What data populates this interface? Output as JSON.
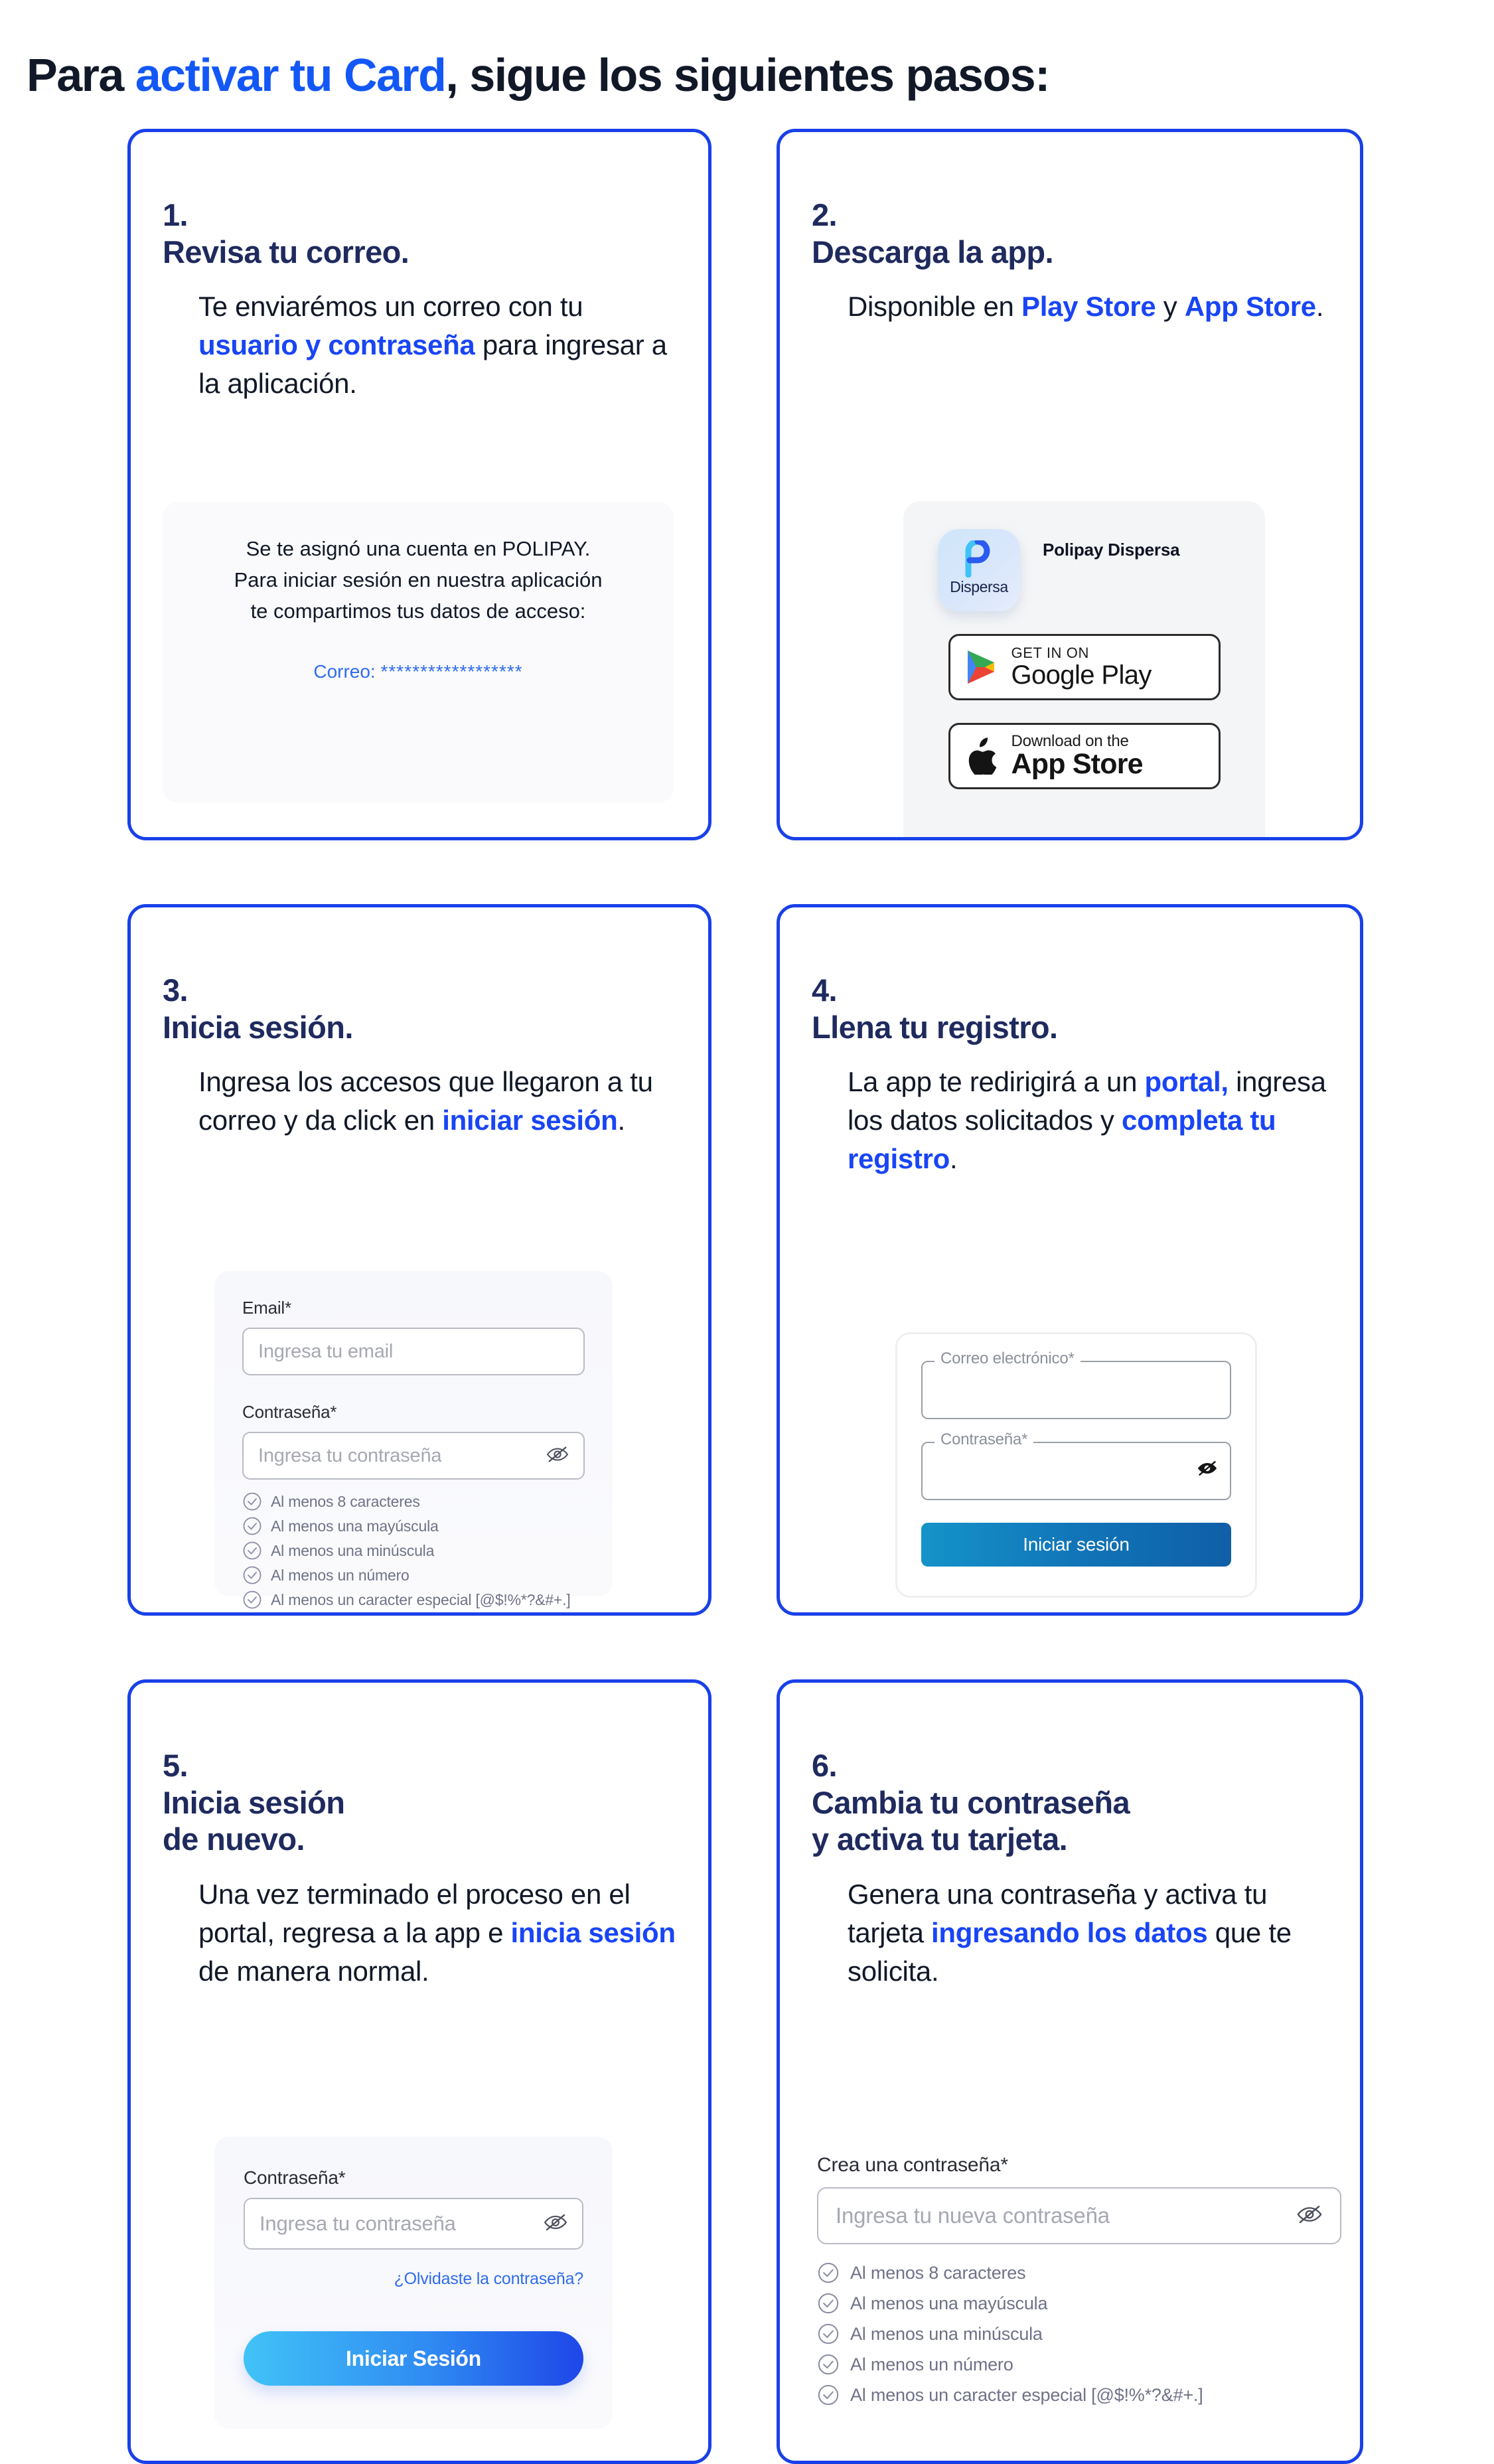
{
  "title": {
    "prefix": "Para ",
    "highlight": "activar tu Card",
    "suffix": ", sigue los siguientes pasos:"
  },
  "steps": [
    {
      "number": "1.",
      "heading": "Revisa tu correo.",
      "body_parts": [
        {
          "text": "Te enviarémos un correo con tu ",
          "style": "normal"
        },
        {
          "text": "usuario y contraseña",
          "style": "highlight"
        },
        {
          "text": " para ingresar a la aplicación.",
          "style": "normal"
        }
      ],
      "email_mock": {
        "body": "Se te asignó una cuenta en POLIPAY. Para iniciar sesión en nuestra aplicación te compartimos tus datos de acceso:",
        "field_label": "Correo:",
        "field_value": "******************"
      }
    },
    {
      "number": "2.",
      "heading": "Descarga la app.",
      "body_parts": [
        {
          "text": "Disponible en ",
          "style": "normal"
        },
        {
          "text": "Play Store",
          "style": "highlight"
        },
        {
          "text": " y ",
          "style": "normal"
        },
        {
          "text": "App Store",
          "style": "highlight"
        },
        {
          "text": ".",
          "style": "normal"
        }
      ],
      "store_mock": {
        "app_icon_name": "Dispersa",
        "app_title": "Polipay Dispersa",
        "google_badge": {
          "top": "GET IN ON",
          "main": "Google Play",
          "icon": "google-play-icon"
        },
        "apple_badge": {
          "top": "Download on the",
          "main": "App Store",
          "icon": "apple-icon"
        }
      }
    },
    {
      "number": "3.",
      "heading": "Inicia sesión.",
      "body_parts": [
        {
          "text": "Ingresa los accesos que llegaron a tu correo y da click en ",
          "style": "normal"
        },
        {
          "text": "iniciar sesión",
          "style": "highlight"
        },
        {
          "text": ".",
          "style": "normal"
        }
      ],
      "form_mock": {
        "email_label": "Email*",
        "email_placeholder": "Ingresa tu email",
        "password_label": "Contraseña*",
        "password_placeholder": "Ingresa tu contraseña",
        "eye_icon": "eye-off-icon",
        "rules": [
          "Al menos 8 caracteres",
          "Al menos una mayúscula",
          "Al menos una minúscula",
          "Al menos un número",
          "Al menos un caracter especial [@$!%*?&#+.]"
        ]
      }
    },
    {
      "number": "4.",
      "heading": "Llena tu registro.",
      "body_parts": [
        {
          "text": "La app te redirigirá a un ",
          "style": "normal"
        },
        {
          "text": "portal,",
          "style": "highlight"
        },
        {
          "text": " ingresa los datos solicitados y ",
          "style": "normal"
        },
        {
          "text": "completa tu registro",
          "style": "highlight"
        },
        {
          "text": ".",
          "style": "normal"
        }
      ],
      "portal_mock": {
        "email_label": "Correo electrónico*",
        "password_label": "Contraseña*",
        "eye_icon": "eye-off-icon",
        "submit_label": "Iniciar sesión"
      }
    },
    {
      "number": "5.",
      "heading": "Inicia sesión\nde nuevo.",
      "body_parts": [
        {
          "text": "Una vez terminado el proceso en el portal, regresa a la app e ",
          "style": "normal"
        },
        {
          "text": "inicia sesión",
          "style": "highlight"
        },
        {
          "text": " de manera normal.",
          "style": "normal"
        }
      ],
      "login_mock": {
        "password_label": "Contraseña*",
        "password_placeholder": "Ingresa tu contraseña",
        "eye_icon": "eye-off-icon",
        "forgot_label": "¿Olvidaste la contraseña?",
        "submit_label": "Iniciar Sesión"
      }
    },
    {
      "number": "6.",
      "heading": "Cambia tu contraseña\ny activa tu tarjeta.",
      "body_parts": [
        {
          "text": "Genera una contraseña y activa tu tarjeta ",
          "style": "normal"
        },
        {
          "text": "ingresando los datos",
          "style": "highlight"
        },
        {
          "text": " que te solicita.",
          "style": "normal"
        }
      ],
      "newpass_mock": {
        "label": "Crea una contraseña*",
        "placeholder": "Ingresa tu nueva contraseña",
        "eye_icon": "eye-off-icon",
        "rules": [
          "Al menos 8 caracteres",
          "Al menos una mayúscula",
          "Al menos una minúscula",
          "Al menos un número",
          "Al menos un caracter especial [@$!%*?&#+.]"
        ]
      }
    }
  ],
  "colors": {
    "brand_blue": "#1357F6",
    "card_border": "#1940E8",
    "heading_navy": "#1F2A5E",
    "link_blue": "#2F6BEF",
    "button_gradient_start": "#41C3F7",
    "button_gradient_end": "#1E46E8",
    "portal_button_start": "#1593C9",
    "portal_button_end": "#0F5FA8",
    "mock_bg": "#F7F8FC"
  }
}
